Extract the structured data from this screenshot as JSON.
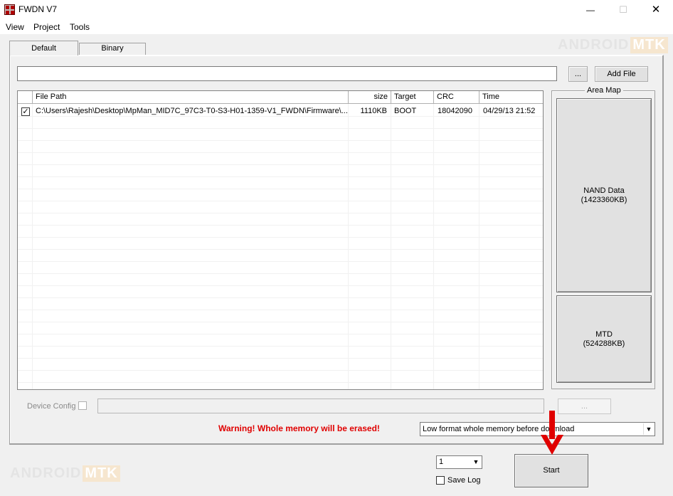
{
  "window": {
    "title": "FWDN V7",
    "minimize_icon": "—",
    "maximize_icon": "☐",
    "close_icon": "✕"
  },
  "menu": [
    "View",
    "Project",
    "Tools"
  ],
  "tabs": [
    {
      "label": "Default",
      "active": true
    },
    {
      "label": "Binary",
      "active": false
    }
  ],
  "file_bar": {
    "path_value": "",
    "browse_label": "...",
    "add_file_label": "Add File"
  },
  "table": {
    "columns": [
      "File Path",
      "size",
      "Target",
      "CRC",
      "Time"
    ],
    "rows": [
      {
        "checked": true,
        "check_glyph": "✓",
        "file_path": "C:\\Users\\Rajesh\\Desktop\\MpMan_MID7C_97C3-T0-S3-H01-1359-V1_FWDN\\Firmware\\...",
        "size": "1110KB",
        "target": "BOOT",
        "crc": "18042090",
        "time": "04/29/13 21:52"
      }
    ]
  },
  "area_map": {
    "title": "Area Map",
    "nand_label": "NAND Data",
    "nand_size": "(1423360KB)",
    "mtd_label": "MTD",
    "mtd_size": "(524288KB)"
  },
  "device_config": {
    "label": "Device Config",
    "checked": false,
    "value": "",
    "browse_label": "..."
  },
  "warning": {
    "text": "Warning! Whole memory will be erased!",
    "color": "#e00000"
  },
  "format_select": {
    "value": "Low format whole memory before download"
  },
  "footer": {
    "count_value": "1",
    "save_log_label": "Save Log",
    "save_log_checked": false,
    "start_label": "Start"
  },
  "watermark": {
    "part1": "ANDROID",
    "part2": "MTK"
  },
  "colors": {
    "arrow": "#e00000",
    "watermark": "#e4e4e4"
  }
}
